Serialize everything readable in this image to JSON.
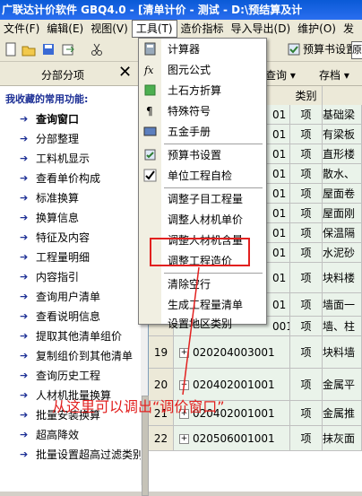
{
  "title": "广联达计价软件 GBQ4.0 - [清单计价 - 测试 - D:\\预结算及计",
  "menu": [
    "文件(F)",
    "编辑(E)",
    "视图(V)",
    "工具(T)",
    "造价指标",
    "导入导出(D)",
    "维护(O)",
    "发"
  ],
  "toolbar": {
    "budget_settings": "预算书设置",
    "query": "查询",
    "archive": "存档",
    "tab_partial": "原"
  },
  "left_panel": {
    "title": "分部分项",
    "close": "✕",
    "section": "我收藏的常用功能:",
    "items": [
      "查询窗口",
      "分部整理",
      "工料机显示",
      "查看单价构成",
      "标准换算",
      "换算信息",
      "特征及内容",
      "工程量明细",
      "内容指引",
      "查询用户清单",
      "查看说明信息",
      "提取其他清单组价",
      "复制组价到其他清单",
      "查询历史工程",
      "人材机批量换算",
      "批量安装换算",
      "超高降效",
      "批量设置超高过滤类别"
    ]
  },
  "grid": {
    "col_type": "类别",
    "rows": [
      {
        "num": "",
        "code": "01",
        "type": "项",
        "name": "基础梁"
      },
      {
        "num": "",
        "code": "01",
        "type": "项",
        "name": "有梁板"
      },
      {
        "num": "",
        "code": "01",
        "type": "项",
        "name": "直形楼"
      },
      {
        "num": "",
        "code": "01",
        "type": "项",
        "name": "散水、"
      },
      {
        "num": "",
        "code": "01",
        "type": "项",
        "name": "屋面卷"
      },
      {
        "num": "",
        "code": "01",
        "type": "项",
        "name": "屋面刚"
      },
      {
        "num": "",
        "code": "01",
        "type": "项",
        "name": "保温隔"
      },
      {
        "num": "",
        "code": "01",
        "type": "项",
        "name": "水泥砂"
      },
      {
        "num": "",
        "code": "01",
        "type": "项",
        "name": "块料楼"
      },
      {
        "num": "",
        "code": "01",
        "type": "项",
        "name": "墙面一"
      },
      {
        "num": "",
        "code": "001",
        "type": "项",
        "name": "墙、柱"
      },
      {
        "num": "19",
        "code": "020204003001",
        "type": "项",
        "name": "块料墙"
      },
      {
        "num": "20",
        "code": "020402001001",
        "type": "项",
        "name": "金属平"
      },
      {
        "num": "21",
        "code": "020402001001",
        "type": "项",
        "name": "金属推"
      },
      {
        "num": "22",
        "code": "020506001001",
        "type": "项",
        "name": "抹灰面"
      }
    ]
  },
  "dropdown": {
    "items": [
      "计算器",
      "图元公式",
      "土石方折算",
      "特殊符号",
      "五金手册",
      "预算书设置",
      "单位工程自检",
      "调整子目工程量",
      "调整人材机单价",
      "调整人材机含量",
      "调整工程造价",
      "清除空行",
      "生成工程量清单",
      "设置地区类别"
    ]
  },
  "annotation": "从这里可以调出“调价窗口”",
  "colors": {
    "accent_red": "#e2201f",
    "title_blue": "#0a5ad6",
    "link_blue": "#1c2f95"
  }
}
